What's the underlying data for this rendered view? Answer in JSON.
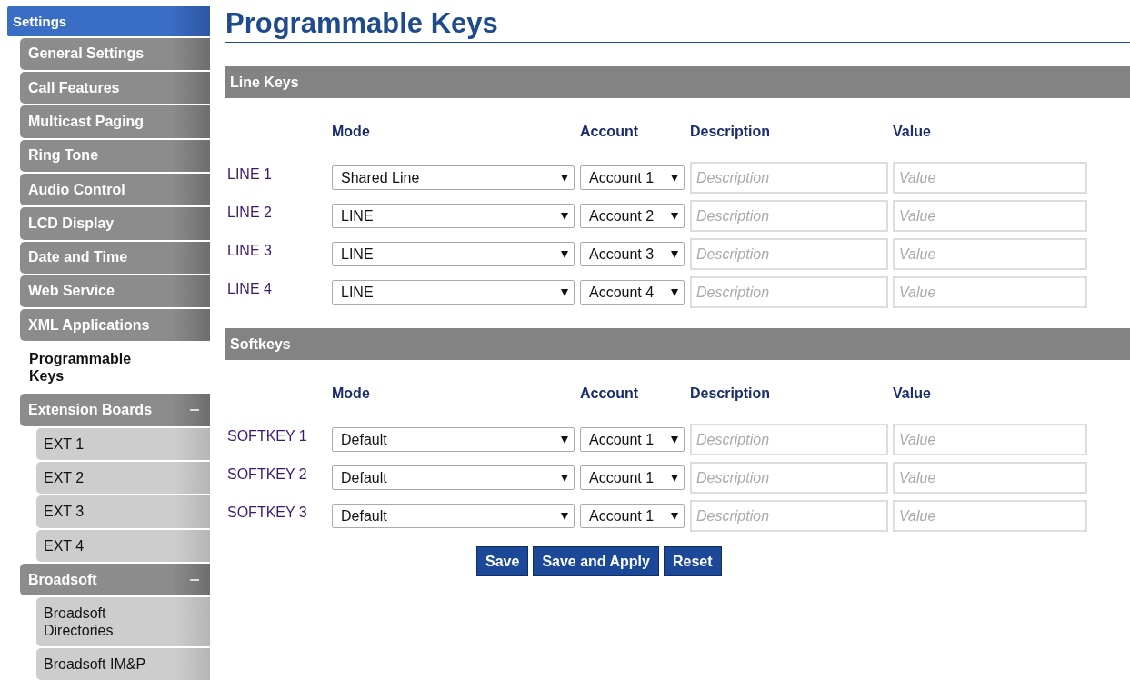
{
  "sidebar": {
    "header": "Settings",
    "items": [
      {
        "label": "General Settings",
        "kind": "item",
        "selected": false
      },
      {
        "label": "Call Features",
        "kind": "item",
        "selected": false
      },
      {
        "label": "Multicast Paging",
        "kind": "item",
        "selected": false
      },
      {
        "label": "Ring Tone",
        "kind": "item",
        "selected": false
      },
      {
        "label": "Audio Control",
        "kind": "item",
        "selected": false
      },
      {
        "label": "LCD Display",
        "kind": "item",
        "selected": false
      },
      {
        "label": "Date and Time",
        "kind": "item",
        "selected": false
      },
      {
        "label": "Web Service",
        "kind": "item",
        "selected": false
      },
      {
        "label": "XML Applications",
        "kind": "item",
        "selected": false
      },
      {
        "label": "Programmable Keys",
        "kind": "item",
        "selected": true
      },
      {
        "label": "Extension Boards",
        "kind": "group",
        "expanded": true,
        "children": [
          {
            "label": "EXT 1"
          },
          {
            "label": "EXT 2"
          },
          {
            "label": "EXT 3"
          },
          {
            "label": "EXT 4"
          }
        ]
      },
      {
        "label": "Broadsoft",
        "kind": "group",
        "expanded": true,
        "children": [
          {
            "label": "Broadsoft Directories"
          },
          {
            "label": "Broadsoft IM&P"
          }
        ]
      }
    ]
  },
  "page_title": "Programmable Keys",
  "sections": [
    {
      "title": "Line Keys",
      "columns": [
        "Mode",
        "Account",
        "Description",
        "Value"
      ],
      "rows": [
        {
          "label": "LINE 1",
          "mode": "Shared Line",
          "account": "Account 1",
          "description_placeholder": "Description",
          "value_placeholder": "Value"
        },
        {
          "label": "LINE 2",
          "mode": "LINE",
          "account": "Account 2",
          "description_placeholder": "Description",
          "value_placeholder": "Value"
        },
        {
          "label": "LINE 3",
          "mode": "LINE",
          "account": "Account 3",
          "description_placeholder": "Description",
          "value_placeholder": "Value"
        },
        {
          "label": "LINE 4",
          "mode": "LINE",
          "account": "Account 4",
          "description_placeholder": "Description",
          "value_placeholder": "Value"
        }
      ]
    },
    {
      "title": "Softkeys",
      "columns": [
        "Mode",
        "Account",
        "Description",
        "Value"
      ],
      "rows": [
        {
          "label": "SOFTKEY 1",
          "mode": "Default",
          "account": "Account 1",
          "description_placeholder": "Description",
          "value_placeholder": "Value"
        },
        {
          "label": "SOFTKEY 2",
          "mode": "Default",
          "account": "Account 1",
          "description_placeholder": "Description",
          "value_placeholder": "Value"
        },
        {
          "label": "SOFTKEY 3",
          "mode": "Default",
          "account": "Account 1",
          "description_placeholder": "Description",
          "value_placeholder": "Value"
        }
      ]
    }
  ],
  "buttons": [
    "Save",
    "Save and Apply",
    "Reset"
  ]
}
